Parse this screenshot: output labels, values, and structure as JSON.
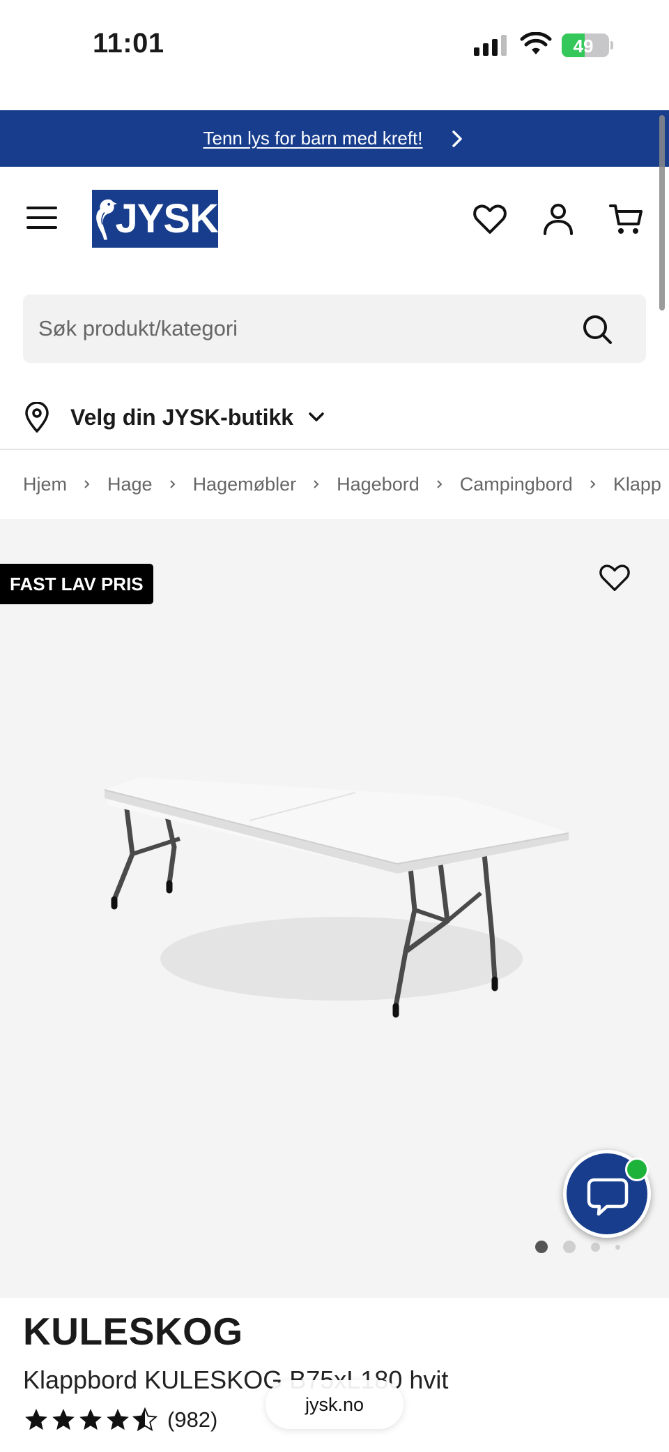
{
  "status_bar": {
    "time": "11:01",
    "battery_level": "49",
    "icons": [
      "cellular-signal-icon",
      "wifi-icon",
      "battery-charging-icon"
    ]
  },
  "promo_banner": {
    "text": "Tenn lys for barn med kreft!",
    "bg_color": "#173d8c"
  },
  "header": {
    "logo_text": "JYSK",
    "icons": [
      "menu-icon",
      "heart-icon",
      "user-icon",
      "cart-icon"
    ]
  },
  "search": {
    "placeholder": "Søk produkt/kategori"
  },
  "store_picker": {
    "label": "Velg din JYSK-butikk"
  },
  "breadcrumb": [
    "Hjem",
    "Hage",
    "Hagemøbler",
    "Hagebord",
    "Campingbord",
    "Klapp"
  ],
  "gallery": {
    "badge": "FAST LAV PRIS",
    "dot_count": 4,
    "active_dot": 0
  },
  "product": {
    "brand": "KULESKOG",
    "name": "Klappbord KULESKOG B75xL180 hvit",
    "rating": 4.5,
    "review_count": "(982)"
  },
  "browser": {
    "url": "jysk.no"
  },
  "colors": {
    "brand_blue": "#173d8c",
    "online_green": "#1db33a"
  }
}
